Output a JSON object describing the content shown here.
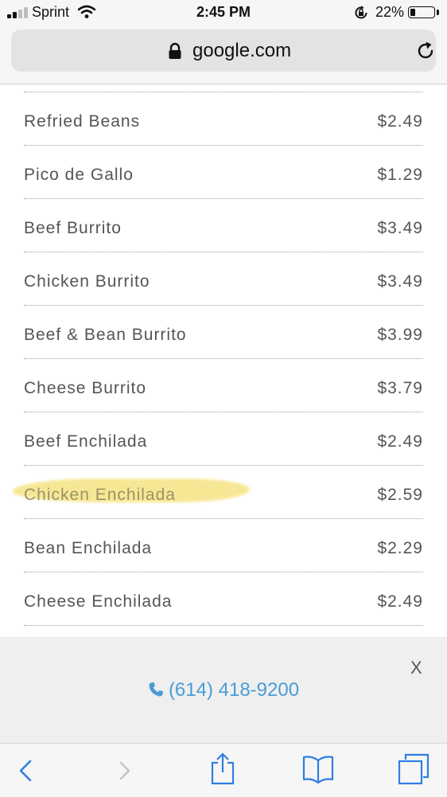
{
  "status_bar": {
    "carrier": "Sprint",
    "time": "2:45 PM",
    "battery_percent": "22%",
    "battery_level": 0.22,
    "icons": [
      "signal-icon",
      "wifi-icon",
      "rotation-lock-icon",
      "battery-icon"
    ]
  },
  "browser": {
    "url": "google.com",
    "icons": [
      "padlock-icon",
      "reload-icon"
    ]
  },
  "menu": {
    "items": [
      {
        "name": "Refried Beans",
        "price": "$2.49"
      },
      {
        "name": "Pico de Gallo",
        "price": "$1.29"
      },
      {
        "name": "Beef Burrito",
        "price": "$3.49"
      },
      {
        "name": "Chicken Burrito",
        "price": "$3.49"
      },
      {
        "name": "Beef & Bean Burrito",
        "price": "$3.99"
      },
      {
        "name": "Cheese Burrito",
        "price": "$3.79"
      },
      {
        "name": "Beef Enchilada",
        "price": "$2.49"
      },
      {
        "name": "Chicken Enchilada",
        "price": "$2.59",
        "highlighted": true
      },
      {
        "name": "Bean Enchilada",
        "price": "$2.29"
      },
      {
        "name": "Cheese Enchilada",
        "price": "$2.49"
      }
    ],
    "highlight_color": "#f6e58a"
  },
  "call_panel": {
    "phone": "(614) 418-9200",
    "close_label": "X",
    "link_color": "#4a9cd6"
  },
  "toolbar": {
    "icons": [
      "back-icon",
      "forward-icon",
      "share-icon",
      "bookmarks-icon",
      "tabs-icon"
    ],
    "accent_color": "#2f7fe0"
  }
}
